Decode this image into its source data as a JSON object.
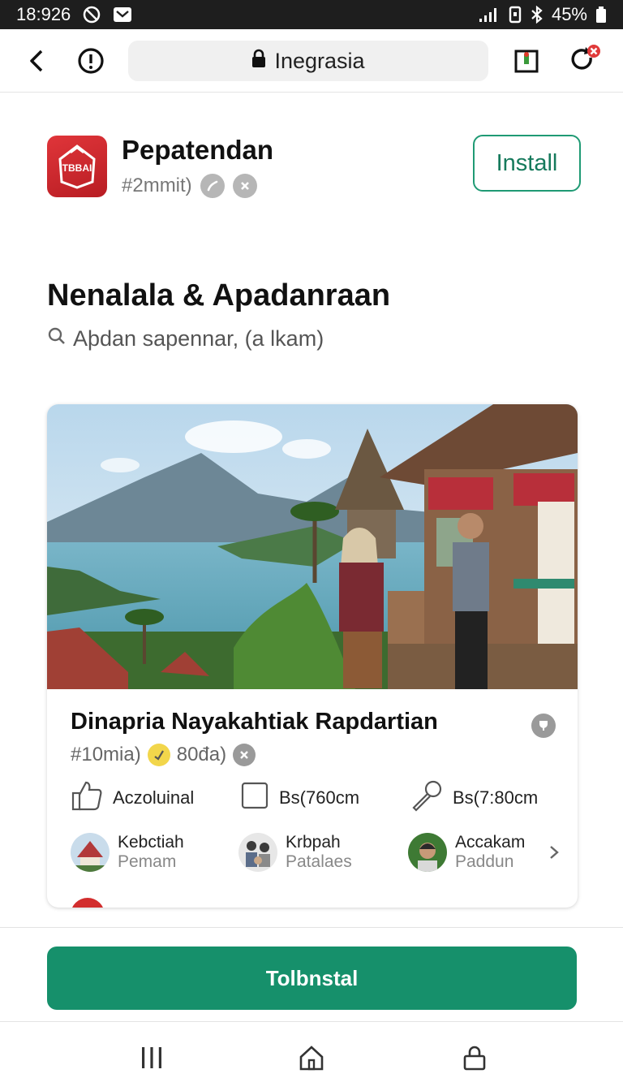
{
  "status_bar": {
    "time": "18:926",
    "battery": "45%"
  },
  "browser": {
    "url_text": "Inegrasia",
    "icons": [
      "back-chevron-icon",
      "info-circle-icon",
      "lock-icon",
      "share-square-icon",
      "refresh-alert-icon"
    ]
  },
  "app": {
    "name": "Pepatendan",
    "icon_text": "TBBAI",
    "subtitle": "#2mmit)",
    "install_label": "Install"
  },
  "section": {
    "title": "Nenalala & Apadanraan",
    "subtitle": "Aþdan sapennar, (a lkam)"
  },
  "card": {
    "title": "Dinapria Nayakahtiak Rapdartian",
    "meta_left": "#10mia)",
    "meta_right": "80đa)",
    "specs": [
      {
        "icon": "thumbs-up-icon",
        "label": "Aczoluinal"
      },
      {
        "icon": "checkbox-icon",
        "label": "Bs(760cm"
      },
      {
        "icon": "microphone-icon",
        "label": "Bs(7:80cm"
      }
    ],
    "contacts": [
      {
        "name": "Kebctiah",
        "role": "Pemam"
      },
      {
        "name": "Krbpah",
        "role": "Patalaes"
      },
      {
        "name": "Accakam",
        "role": "Paddun"
      }
    ]
  },
  "primary_button": {
    "label": "Tolbnstal"
  },
  "colors": {
    "accent_green": "#16906b",
    "brand_red": "#d32b30",
    "status_bar": "#1e1e1e"
  }
}
